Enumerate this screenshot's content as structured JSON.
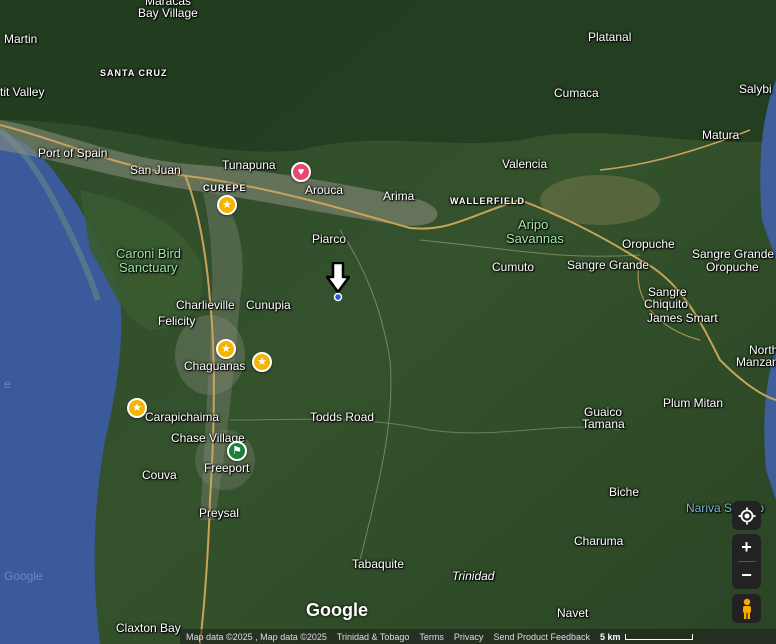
{
  "places": {
    "maracas_bay_village_1": "Maracas",
    "maracas_bay_village_2": "Bay Village",
    "martin": "Martin",
    "santa_cruz": "SANTA CRUZ",
    "platanal": "Platanal",
    "salybia": "Salybi",
    "petit_valley": "tit Valley",
    "cumaca": "Cumaca",
    "matura": "Matura",
    "port_of_spain": "Port of Spain",
    "tunapuna": "Tunapuna",
    "valencia": "Valencia",
    "san_juan": "San Juan",
    "curepe": "CUREPE",
    "arouca": "Arouca",
    "arima": "Arima",
    "wallerfield": "WALLERFIELD",
    "aripo_1": "Aripo",
    "aripo_2": "Savannas",
    "caroni_1": "Caroni Bird",
    "caroni_2": "Sanctuary",
    "piarco": "Piarco",
    "oropuche": "Oropuche",
    "sangre_grande_1": "Sangre Grande",
    "sangre_grande_oropuche_1": "Sangre Grande",
    "sangre_grande_oropuche_2": "Oropuche",
    "cumuto": "Cumuto",
    "sangre_chiquito_1": "Sangre",
    "sangre_chiquito_2": "Chiquito",
    "charlieville": "Charlieville",
    "cunupia": "Cunupia",
    "felicity": "Felicity",
    "james_smart": "James Smart",
    "north_manzanilla_1": "North",
    "north_manzanilla_2": "Manzan",
    "chaguanas": "Chaguanas",
    "carapichaima": "Carapichaima",
    "todds_road": "Todds Road",
    "plum_mitan": "Plum Mitan",
    "guaico_tamana_1": "Guaico",
    "guaico_tamana_2": "Tamana",
    "chase_village": "Chase Village",
    "freeport": "Freeport",
    "couva": "Couva",
    "biche": "Biche",
    "nariva_swamp": "Nariva Swamp",
    "preysal": "Preysal",
    "charuma": "Charuma",
    "tabaquite": "Tabaquite",
    "trinidad": "Trinidad",
    "claxton_bay": "Claxton Bay",
    "navet": "Navet",
    "water_google": "Google",
    "water_letter": "e"
  },
  "logo": "Google",
  "footer": {
    "map_data": "Map data ©2025 , Map data ©2025",
    "country": "Trinidad & Tobago",
    "terms": "Terms",
    "privacy": "Privacy",
    "feedback": "Send Product Feedback",
    "scale": "5 km"
  },
  "controls": {
    "zoom_in": "+",
    "zoom_out": "−"
  },
  "colors": {
    "sea": "#3a5a9c",
    "land": "#2f4a27",
    "urban": "#8c8f80",
    "road": "#c8a45a",
    "star_pin": "#f4b400",
    "heart_pin": "#e8476f",
    "flag_pin": "#188038"
  },
  "icons": {
    "locate": "my-location-icon",
    "pegman": "street-view-pegman-icon",
    "marker": "down-arrow-marker-icon"
  }
}
